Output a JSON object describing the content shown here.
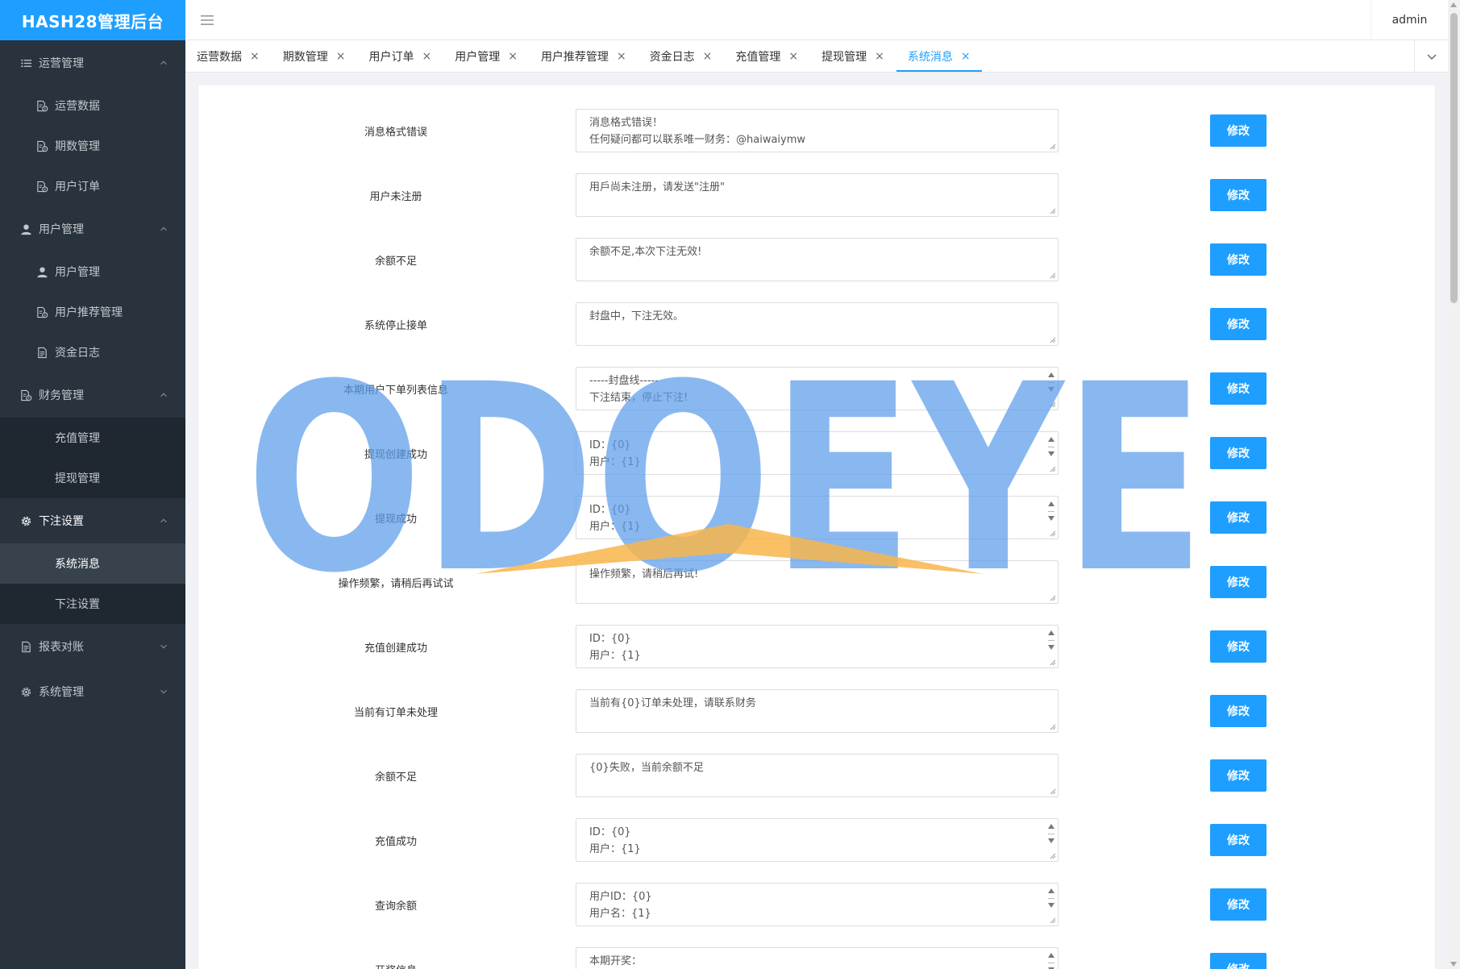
{
  "brand": "HASH28管理后台",
  "user": "admin",
  "sidebar": {
    "groups": [
      {
        "label": "运营管理",
        "items": [
          "运营数据",
          "期数管理",
          "用户订单"
        ]
      },
      {
        "label": "用户管理",
        "items": [
          "用户管理",
          "用户推荐管理",
          "资金日志"
        ]
      },
      {
        "label": "财务管理",
        "items": [
          "充值管理",
          "提现管理"
        ]
      },
      {
        "label": "下注设置",
        "items": [
          "系统消息",
          "下注设置"
        ]
      },
      {
        "label": "报表对账",
        "items": []
      },
      {
        "label": "系统管理",
        "items": []
      }
    ]
  },
  "tabs": [
    {
      "label": "运营数据"
    },
    {
      "label": "期数管理"
    },
    {
      "label": "用户订单"
    },
    {
      "label": "用户管理"
    },
    {
      "label": "用户推荐管理"
    },
    {
      "label": "资金日志"
    },
    {
      "label": "充值管理"
    },
    {
      "label": "提现管理"
    },
    {
      "label": "系统消息"
    }
  ],
  "tab_close_glyph": "×",
  "active_tab": "系统消息",
  "button_label": "修改",
  "rows": [
    {
      "label": "消息格式错误",
      "lines": [
        "消息格式错误！",
        "任何疑问都可以联系唯一财务：@haiwaiymw"
      ]
    },
    {
      "label": "用户未注册",
      "lines": [
        "用戶尚未注册，请发送\"注册\""
      ]
    },
    {
      "label": "余额不足",
      "lines": [
        "余额不足,本次下注无效!"
      ]
    },
    {
      "label": "系统停止接单",
      "lines": [
        "封盘中，下注无效。"
      ]
    },
    {
      "label": "本期用户下单列表信息",
      "lines": [
        "-----封盘线-----",
        "下注结束，停止下注!"
      ]
    },
    {
      "label": "提现创建成功",
      "lines": [
        "ID：{0}",
        "用户：{1}"
      ]
    },
    {
      "label": "提现成功",
      "lines": [
        "ID：{0}",
        "用户：{1}"
      ]
    },
    {
      "label": "操作频繁，请稍后再试试",
      "lines": [
        "操作频繁，请稍后再试!"
      ]
    },
    {
      "label": "充值创建成功",
      "lines": [
        "ID：{0}",
        "用户：{1}"
      ]
    },
    {
      "label": "当前有订单未处理",
      "lines": [
        "当前有{0}订单未处理，请联系财务"
      ]
    },
    {
      "label": "余额不足",
      "lines": [
        "{0}失败，当前余额不足"
      ]
    },
    {
      "label": "充值成功",
      "lines": [
        "ID：{0}",
        "用户：{1}"
      ]
    },
    {
      "label": "查询余额",
      "lines": [
        "用户ID：{0}",
        "用户名：{1}"
      ]
    },
    {
      "label": "开奖信息",
      "lines": [
        "本期开奖："
      ]
    }
  ],
  "watermark": "ODOEYE",
  "colors": {
    "accent": "#1e9fff",
    "sidebar": "#28333e",
    "watermark": "#5b9cea",
    "watermark_accent": "#f8b54b"
  }
}
